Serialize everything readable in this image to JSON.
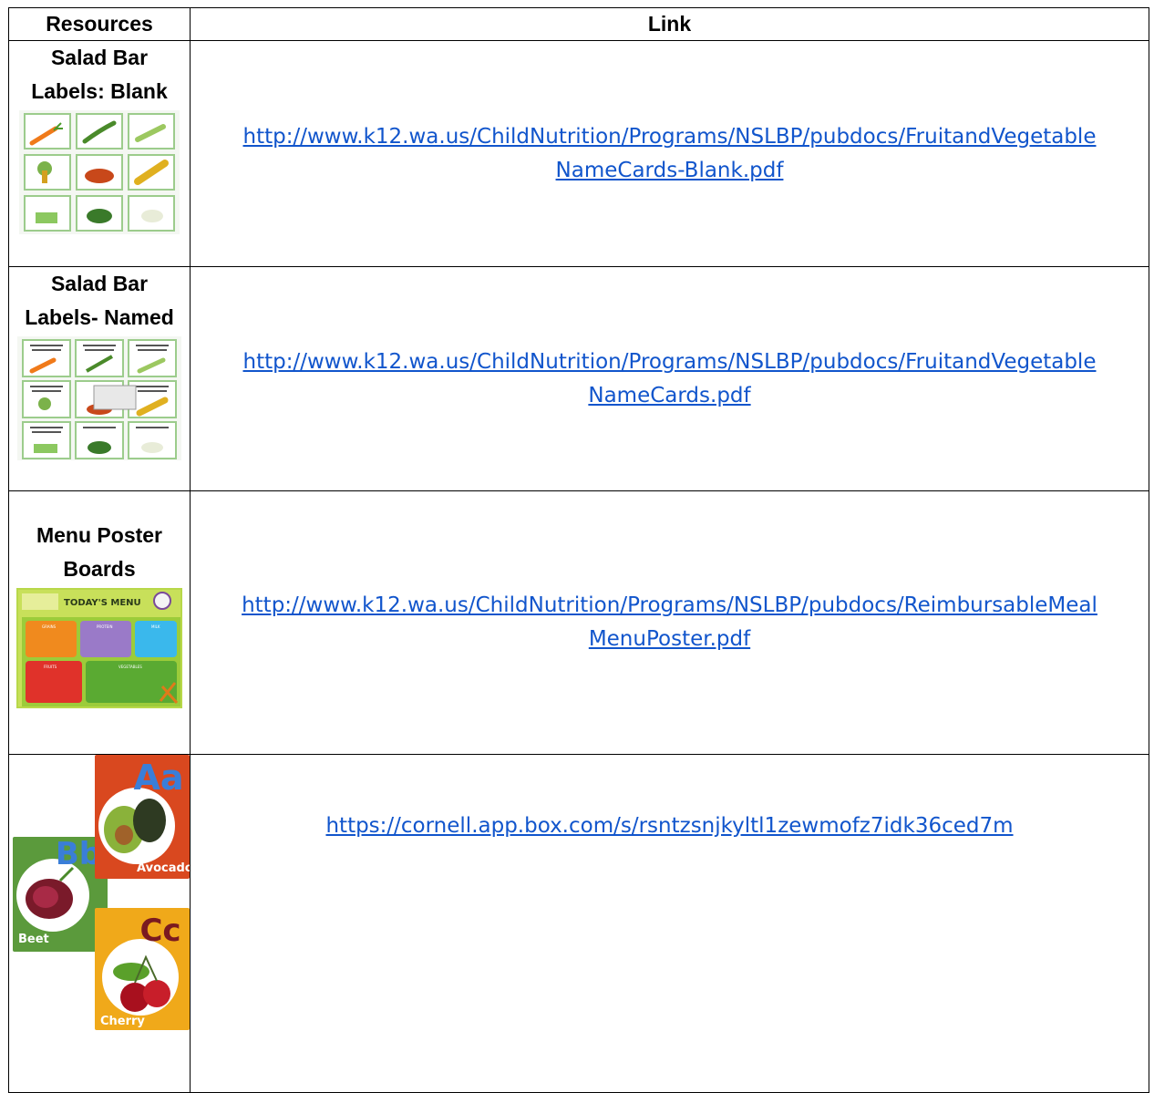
{
  "table": {
    "headers": {
      "resources": "Resources",
      "link": "Link"
    },
    "rows": [
      {
        "label_lines": [
          "Salad Bar",
          "Labels: Blank"
        ],
        "link_lines": [
          "http://www.k12.wa.us/ChildNutrition/Programs/NSLBP/pubdocs/FruitandVegetable",
          "NameCards-Blank.pdf"
        ]
      },
      {
        "label_lines": [
          "Salad Bar",
          "Labels- Named"
        ],
        "link_lines": [
          "http://www.k12.wa.us/ChildNutrition/Programs/NSLBP/pubdocs/FruitandVegetable",
          "NameCards.pdf"
        ]
      },
      {
        "label_lines": [
          "Menu Poster",
          "Boards"
        ],
        "link_lines": [
          "http://www.k12.wa.us/ChildNutrition/Programs/NSLBP/pubdocs/ReimbursableMeal",
          "MenuPoster.pdf"
        ],
        "poster": {
          "title": "TODAY'S MENU",
          "sections": [
            "GRAINS",
            "PROTEIN",
            "MILK",
            "FRUITS",
            "VEGETABLES"
          ]
        }
      },
      {
        "link_lines": [
          "https://cornell.app.box.com/s/rsntzsnjkyltl1zewmofz7idk36ced7m"
        ],
        "cards": [
          {
            "letters": "Aa",
            "word": "Avocado",
            "color": "#d9481f"
          },
          {
            "letters": "Bb",
            "word": "Beet",
            "color": "#5b9a3c"
          },
          {
            "letters": "Cc",
            "word": "Cherry",
            "color": "#f0a91a"
          }
        ]
      }
    ]
  }
}
